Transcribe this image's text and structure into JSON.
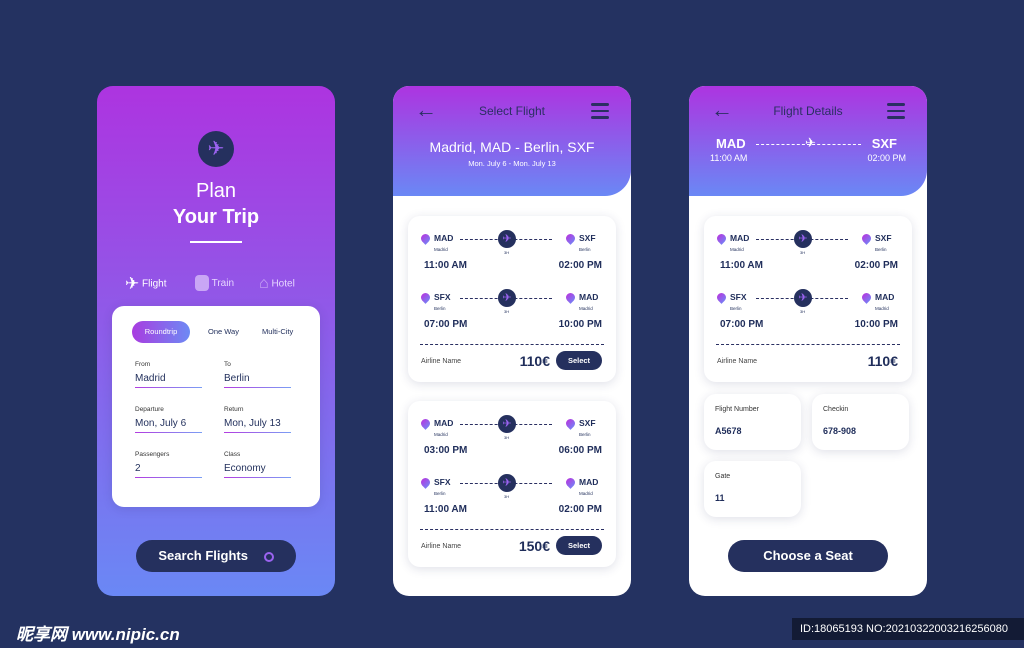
{
  "colors": {
    "background": "#243261",
    "gradient_top": "#ad34e0",
    "gradient_bottom": "#6a88f5",
    "dark": "#25305e"
  },
  "plan": {
    "title_line1": "Plan",
    "title_line2": "Your Trip",
    "modes": [
      {
        "icon": "airplane-icon",
        "label": "Flight"
      },
      {
        "icon": "train-icon",
        "label": "Train"
      },
      {
        "icon": "house-icon",
        "label": "Hotel"
      }
    ],
    "trip_types": [
      "Roundtrip",
      "One Way",
      "Multi-City"
    ],
    "fields": [
      {
        "label": "From",
        "value": "Madrid"
      },
      {
        "label": "To",
        "value": "Berlin"
      },
      {
        "label": "Departure",
        "value": "Mon, July 6"
      },
      {
        "label": "Return",
        "value": "Mon, July 13"
      },
      {
        "label": "Passengers",
        "value": "2"
      },
      {
        "label": "Class",
        "value": "Economy"
      }
    ],
    "search_label": "Search Flights"
  },
  "select": {
    "title": "Select Flight",
    "route": "Madrid, MAD - Berlin, SXF",
    "dates": "Mon. July 6 - Mon. July 13",
    "flights": [
      {
        "legs": [
          {
            "from": "MAD",
            "from_city": "Madrid",
            "to": "SXF",
            "to_city": "Berlin",
            "duration": "3H",
            "dep": "11:00 AM",
            "arr": "02:00 PM"
          },
          {
            "from": "SFX",
            "from_city": "Berlin",
            "to": "MAD",
            "to_city": "Madrid",
            "duration": "3H",
            "dep": "07:00 PM",
            "arr": "10:00 PM"
          }
        ],
        "airline": "Airline Name",
        "price": "110€",
        "select": "Select"
      },
      {
        "legs": [
          {
            "from": "MAD",
            "from_city": "Madrid",
            "to": "SXF",
            "to_city": "Berlin",
            "duration": "3H",
            "dep": "03:00 PM",
            "arr": "06:00 PM"
          },
          {
            "from": "SFX",
            "from_city": "Berlin",
            "to": "MAD",
            "to_city": "Madrid",
            "duration": "3H",
            "dep": "11:00 AM",
            "arr": "02:00 PM"
          }
        ],
        "airline": "Airline Name",
        "price": "150€",
        "select": "Select"
      }
    ]
  },
  "details": {
    "title": "Flight Details",
    "from": "MAD",
    "to": "SXF",
    "dep": "11:00 AM",
    "arr": "02:00 PM",
    "flight": {
      "legs": [
        {
          "from": "MAD",
          "from_city": "Madrid",
          "to": "SXF",
          "to_city": "Berlin",
          "duration": "3H",
          "dep": "11:00 AM",
          "arr": "02:00 PM"
        },
        {
          "from": "SFX",
          "from_city": "Berlin",
          "to": "MAD",
          "to_city": "Madrid",
          "duration": "3H",
          "dep": "07:00 PM",
          "arr": "10:00 PM"
        }
      ],
      "airline": "Airline Name",
      "price": "110€"
    },
    "info": [
      {
        "label": "Flight Number",
        "value": "A5678"
      },
      {
        "label": "Checkin",
        "value": "678-908"
      },
      {
        "label": "Gate",
        "value": "11"
      }
    ],
    "seat_label": "Choose a Seat"
  },
  "watermark": {
    "logo": "昵享网 www.nipic.cn",
    "id": "ID:18065193 NO:20210322003216256080"
  }
}
